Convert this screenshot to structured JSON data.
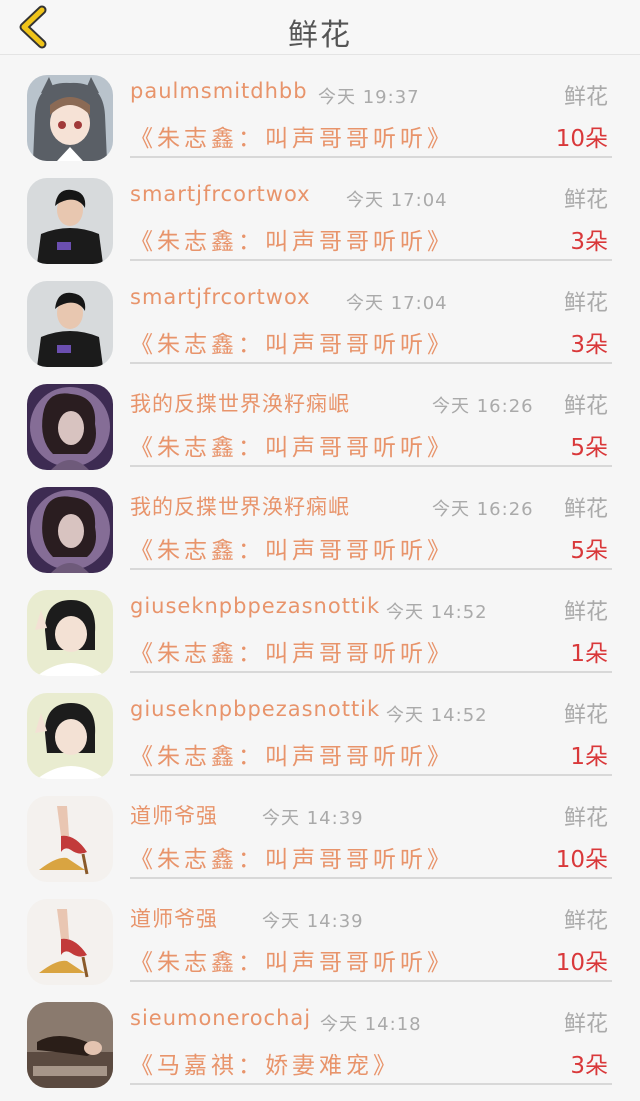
{
  "header": {
    "title": "鲜花",
    "back_icon": "chevron-left-icon",
    "accent": "#f0c419"
  },
  "rows": [
    {
      "username": "paulmsmitdhbb",
      "time": "今天 19:37",
      "type": "鲜花",
      "book": "《朱志鑫：叫声哥哥听听》",
      "count": "10朵",
      "avatar": "anime-girl-hoodie"
    },
    {
      "username": "smartjfrcortwox",
      "time": "今天 17:04",
      "type": "鲜花",
      "book": "《朱志鑫：叫声哥哥听听》",
      "count": "3朵",
      "avatar": "boy-black-shirt"
    },
    {
      "username": "smartjfrcortwox",
      "time": "今天 17:04",
      "type": "鲜花",
      "book": "《朱志鑫：叫声哥哥听听》",
      "count": "3朵",
      "avatar": "boy-black-shirt"
    },
    {
      "username": "我的反揲世界涣籽痫岷",
      "time": "今天 16:26",
      "type": "鲜花",
      "book": "《朱志鑫：叫声哥哥听听》",
      "count": "5朵",
      "avatar": "purple-portrait"
    },
    {
      "username": "我的反揲世界涣籽痫岷",
      "time": "今天 16:26",
      "type": "鲜花",
      "book": "《朱志鑫：叫声哥哥听听》",
      "count": "5朵",
      "avatar": "purple-portrait"
    },
    {
      "username": "giuseknpbpezasnottik",
      "time": "今天 14:52",
      "type": "鲜花",
      "book": "《朱志鑫：叫声哥哥听听》",
      "count": "1朵",
      "avatar": "girl-peace-sign"
    },
    {
      "username": "giuseknpbpezasnottik",
      "time": "今天 14:52",
      "type": "鲜花",
      "book": "《朱志鑫：叫声哥哥听听》",
      "count": "1朵",
      "avatar": "girl-peace-sign"
    },
    {
      "username": "道师爷强",
      "time": "今天 14:39",
      "type": "鲜花",
      "book": "《朱志鑫：叫声哥哥听听》",
      "count": "10朵",
      "avatar": "high-heel-shoe"
    },
    {
      "username": "道师爷强",
      "time": "今天 14:39",
      "type": "鲜花",
      "book": "《朱志鑫：叫声哥哥听听》",
      "count": "10朵",
      "avatar": "high-heel-shoe"
    },
    {
      "username": "sieumonerochaj",
      "time": "今天 14:18",
      "type": "鲜花",
      "book": "《马嘉祺：娇妻难宠》",
      "count": "3朵",
      "avatar": "lying-girl"
    }
  ]
}
